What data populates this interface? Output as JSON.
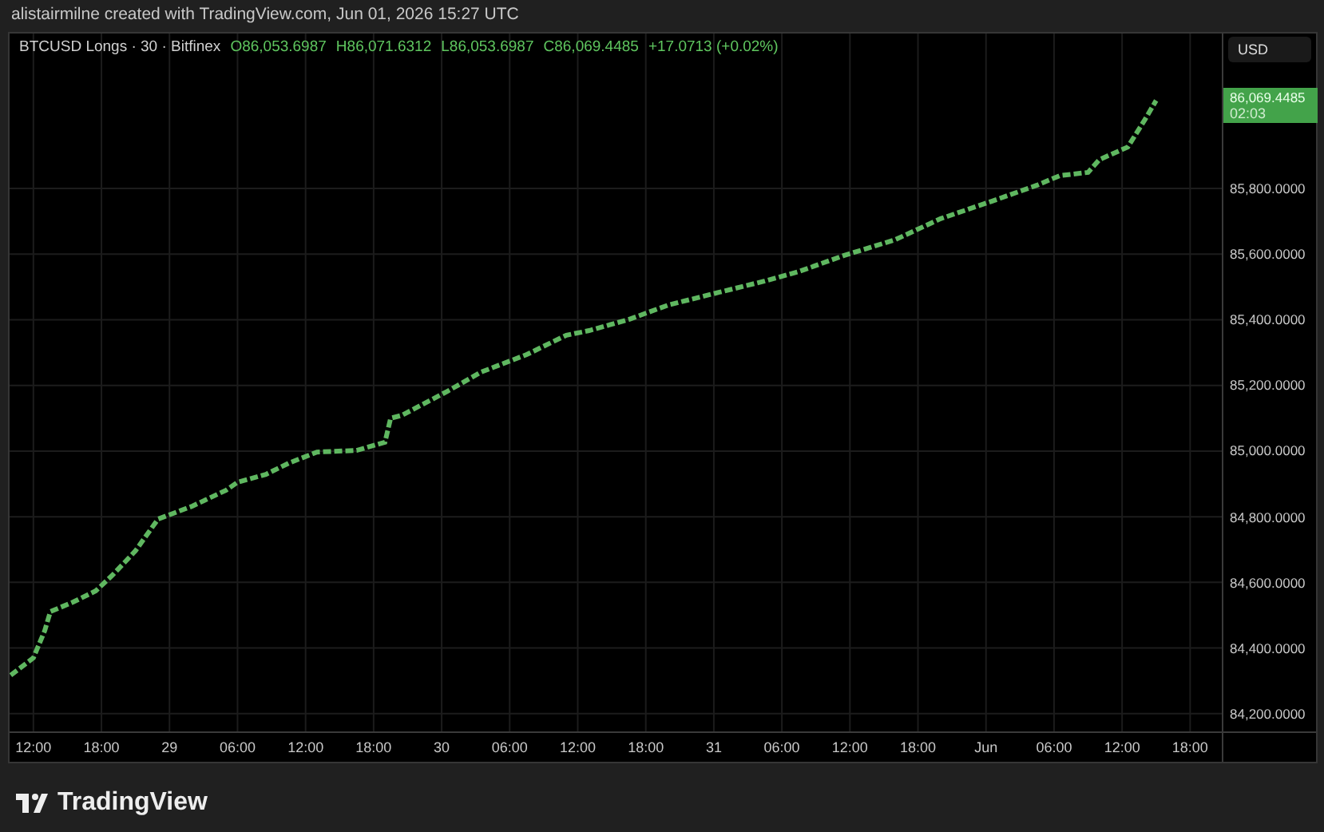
{
  "caption": "alistairmilne created with TradingView.com, Jun 01, 2026 15:27 UTC",
  "legend": {
    "symbol": "BTCUSD Longs · 30 · Bitfinex",
    "values": [
      "O86,053.6987",
      "H86,071.6312",
      "L86,053.6987",
      "C86,069.4485",
      "+17.0713 (+0.02%)"
    ]
  },
  "price_axis": {
    "currency": "USD",
    "last_price": "86,069.4485",
    "countdown": "02:03"
  },
  "chart_data": {
    "type": "line",
    "grid": true,
    "xlim": [
      "2026-05-28T09:54",
      "2026-06-02T05:06"
    ],
    "ylim": [
      84146,
      86272
    ],
    "xticks": [
      {
        "value": "2026-05-28T12:00",
        "label": "12:00"
      },
      {
        "value": "2026-05-28T18:00",
        "label": "18:00"
      },
      {
        "value": "2026-05-29T00:00",
        "label": "29"
      },
      {
        "value": "2026-05-29T06:00",
        "label": "06:00"
      },
      {
        "value": "2026-05-29T12:00",
        "label": "12:00"
      },
      {
        "value": "2026-05-29T18:00",
        "label": "18:00"
      },
      {
        "value": "2026-05-30T00:00",
        "label": "30"
      },
      {
        "value": "2026-05-30T06:00",
        "label": "06:00"
      },
      {
        "value": "2026-05-30T12:00",
        "label": "12:00"
      },
      {
        "value": "2026-05-30T18:00",
        "label": "18:00"
      },
      {
        "value": "2026-05-31T00:00",
        "label": "31"
      },
      {
        "value": "2026-05-31T06:00",
        "label": "06:00"
      },
      {
        "value": "2026-05-31T12:00",
        "label": "12:00"
      },
      {
        "value": "2026-05-31T18:00",
        "label": "18:00"
      },
      {
        "value": "2026-06-01T00:00",
        "label": "Jun"
      },
      {
        "value": "2026-06-01T06:00",
        "label": "06:00"
      },
      {
        "value": "2026-06-01T12:00",
        "label": "12:00"
      },
      {
        "value": "2026-06-01T18:00",
        "label": "18:00"
      }
    ],
    "yticks": [
      {
        "value": 84200,
        "label": "84,200.0000"
      },
      {
        "value": 84400,
        "label": "84,400.0000"
      },
      {
        "value": 84600,
        "label": "84,600.0000"
      },
      {
        "value": 84800,
        "label": "84,800.0000"
      },
      {
        "value": 85000,
        "label": "85,000.0000"
      },
      {
        "value": 85200,
        "label": "85,200.0000"
      },
      {
        "value": 85400,
        "label": "85,400.0000"
      },
      {
        "value": 85600,
        "label": "85,600.0000"
      },
      {
        "value": 85800,
        "label": "85,800.0000"
      }
    ],
    "x": [
      "2026-05-28T10:00",
      "2026-05-28T12:00",
      "2026-05-28T13:00",
      "2026-05-28T13:30",
      "2026-05-28T15:30",
      "2026-05-28T17:30",
      "2026-05-28T19:00",
      "2026-05-28T21:00",
      "2026-05-28T22:30",
      "2026-05-28T23:00",
      "2026-05-29T02:00",
      "2026-05-29T05:00",
      "2026-05-29T06:00",
      "2026-05-29T08:30",
      "2026-05-29T10:30",
      "2026-05-29T13:00",
      "2026-05-29T16:30",
      "2026-05-29T19:00",
      "2026-05-29T19:30",
      "2026-05-29T20:30",
      "2026-05-30T00:30",
      "2026-05-30T03:30",
      "2026-05-30T07:30",
      "2026-05-30T11:00",
      "2026-05-30T13:00",
      "2026-05-30T16:30",
      "2026-05-30T20:00",
      "2026-05-31T00:30",
      "2026-05-31T04:30",
      "2026-05-31T07:30",
      "2026-05-31T11:30",
      "2026-05-31T16:00",
      "2026-05-31T20:00",
      "2026-06-01T00:30",
      "2026-06-01T04:30",
      "2026-06-01T06:30",
      "2026-06-01T09:00",
      "2026-06-01T10:00",
      "2026-06-01T12:30",
      "2026-06-01T14:00",
      "2026-06-01T15:00"
    ],
    "series": [
      {
        "color": "#5fb760",
        "line_style": "dashed",
        "values": [
          84317,
          84370,
          84453,
          84511,
          84540,
          84574,
          84623,
          84696,
          84769,
          84793,
          84832,
          84881,
          84905,
          84929,
          84963,
          84997,
          85002,
          85027,
          85100,
          85109,
          85182,
          85241,
          85294,
          85353,
          85367,
          85401,
          85445,
          85484,
          85518,
          85547,
          85596,
          85644,
          85708,
          85761,
          85810,
          85839,
          85849,
          85888,
          85926,
          86009,
          86068
        ]
      }
    ]
  },
  "brand": "TradingView"
}
